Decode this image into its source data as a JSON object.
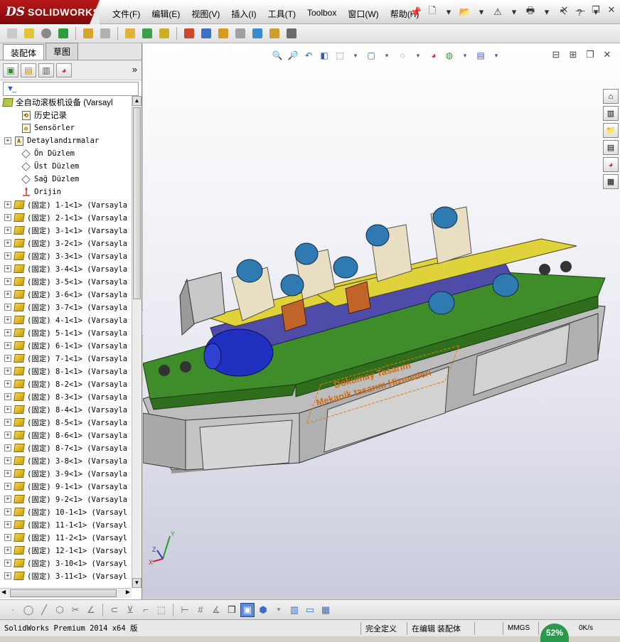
{
  "app": {
    "logo_prefix": "DS",
    "logo_name": "SOLIDWORKS"
  },
  "menu": [
    "文件(F)",
    "编辑(E)",
    "视图(V)",
    "插入(I)",
    "工具(T)",
    "Toolbox",
    "窗口(W)",
    "帮助(H)"
  ],
  "tabs": {
    "assembly": "装配体",
    "sketch": "草图"
  },
  "tree": {
    "root": "全自动滚板机设备  (Varsayl",
    "items": [
      {
        "label": "历史记录",
        "icon": "history-icon",
        "expand": false
      },
      {
        "label": "Sensörler",
        "icon": "sensor-icon",
        "expand": false
      },
      {
        "label": "Detaylandırmalar",
        "icon": "annotation-icon",
        "expand": true
      },
      {
        "label": "Ön Düzlem",
        "icon": "plane-icon",
        "expand": false
      },
      {
        "label": "Üst Düzlem",
        "icon": "plane-icon",
        "expand": false
      },
      {
        "label": "Sağ Düzlem",
        "icon": "plane-icon",
        "expand": false
      },
      {
        "label": "Orijin",
        "icon": "origin-icon",
        "expand": false
      }
    ],
    "components": [
      "(固定) 1-1<1> (Varsayla",
      "(固定) 2-1<1> (Varsayla",
      "(固定) 3-1<1> (Varsayla",
      "(固定) 3-2<1> (Varsayla",
      "(固定) 3-3<1> (Varsayla",
      "(固定) 3-4<1> (Varsayla",
      "(固定) 3-5<1> (Varsayla",
      "(固定) 3-6<1> (Varsayla",
      "(固定) 3-7<1> (Varsayla",
      "(固定) 4-1<1> (Varsayla",
      "(固定) 5-1<1> (Varsayla",
      "(固定) 6-1<1> (Varsayla",
      "(固定) 7-1<1> (Varsayla",
      "(固定) 8-1<1> (Varsayla",
      "(固定) 8-2<1> (Varsayla",
      "(固定) 8-3<1> (Varsayla",
      "(固定) 8-4<1> (Varsayla",
      "(固定) 8-5<1> (Varsayla",
      "(固定) 8-6<1> (Varsayla",
      "(固定) 8-7<1> (Varsayla",
      "(固定) 3-8<1> (Varsayla",
      "(固定) 3-9<1> (Varsayla",
      "(固定) 9-1<1> (Varsayla",
      "(固定) 9-2<1> (Varsayla",
      "(固定) 10-1<1> (Varsayl",
      "(固定) 11-1<1> (Varsayl",
      "(固定) 11-2<1> (Varsayl",
      "(固定) 12-1<1> (Varsayl",
      "(固定) 3-10<1> (Varsayl",
      "(固定) 3-11<1> (Varsayl"
    ]
  },
  "model_text": {
    "line1": "Dokumay Tasarım",
    "line2": "Mekanik tasarım Hizmetleri"
  },
  "triad": {
    "x": "X",
    "y": "Y",
    "z": "Z"
  },
  "status": {
    "version": "SolidWorks Premium 2014 x64 版",
    "defined": "完全定义",
    "editing": "在编辑 装配体",
    "units": "MMGS",
    "percent": "52%",
    "speed": "0K/s"
  }
}
